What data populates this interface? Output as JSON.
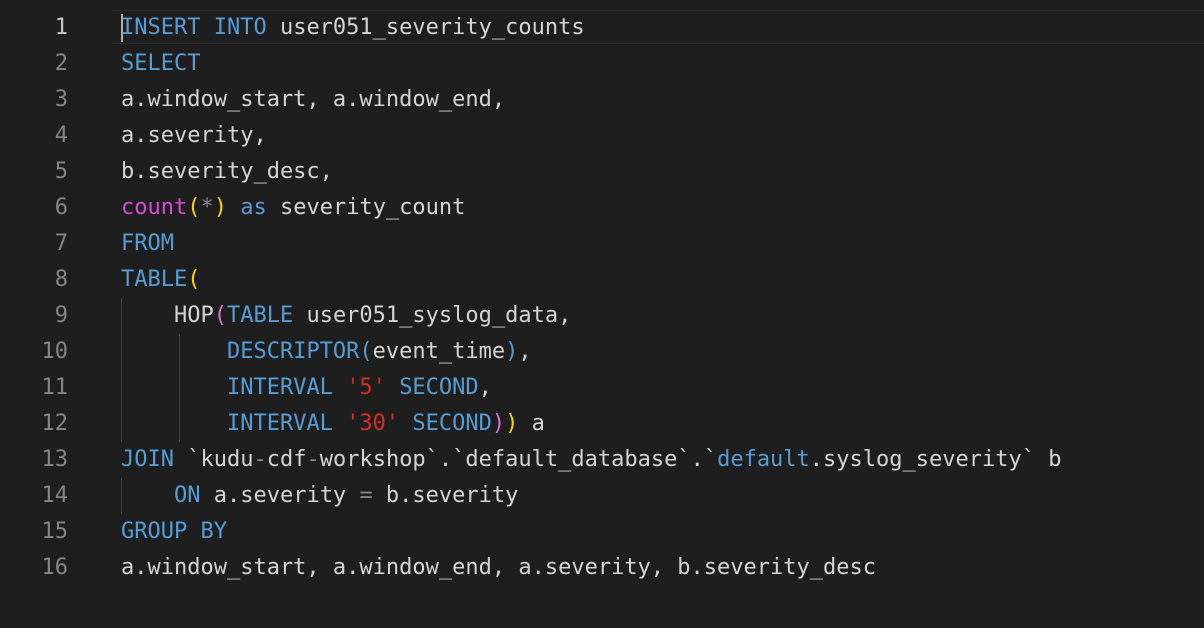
{
  "editor": {
    "language": "sql",
    "colors": {
      "background": "#1e1e1e",
      "line_number": "#858585",
      "line_number_active": "#c6c6c6",
      "text": "#d4d4d4",
      "keyword": "#569cd6",
      "function": "#d44cd4",
      "string": "#d4301f",
      "bracket_level1": "#ffd700",
      "bracket_level2": "#da70d6",
      "bracket_level3": "#569cd6"
    },
    "lines": [
      {
        "number": "1",
        "t": [
          {
            "c": "kw",
            "v": "INSERT INTO"
          },
          {
            "c": "",
            "v": " user051_severity_counts"
          }
        ]
      },
      {
        "number": "2",
        "t": [
          {
            "c": "kw",
            "v": "SELECT"
          }
        ]
      },
      {
        "number": "3",
        "t": [
          {
            "c": "",
            "v": "a.window_start, a.window_end,"
          }
        ]
      },
      {
        "number": "4",
        "t": [
          {
            "c": "",
            "v": "a.severity,"
          }
        ]
      },
      {
        "number": "5",
        "t": [
          {
            "c": "",
            "v": "b.severity_desc,"
          }
        ]
      },
      {
        "number": "6",
        "t": [
          {
            "c": "fn",
            "v": "count"
          },
          {
            "c": "p1",
            "v": "("
          },
          {
            "c": "op",
            "v": "*"
          },
          {
            "c": "p1",
            "v": ")"
          },
          {
            "c": "",
            "v": " "
          },
          {
            "c": "kw",
            "v": "as"
          },
          {
            "c": "",
            "v": " severity_count"
          }
        ]
      },
      {
        "number": "7",
        "t": [
          {
            "c": "kw",
            "v": "FROM"
          }
        ]
      },
      {
        "number": "8",
        "t": [
          {
            "c": "kw",
            "v": "TABLE"
          },
          {
            "c": "p1",
            "v": "("
          }
        ]
      },
      {
        "number": "9",
        "t": [
          {
            "c": "",
            "v": "    HOP"
          },
          {
            "c": "p2",
            "v": "("
          },
          {
            "c": "kw",
            "v": "TABLE"
          },
          {
            "c": "",
            "v": " user051_syslog_data,"
          }
        ]
      },
      {
        "number": "10",
        "t": [
          {
            "c": "",
            "v": "        "
          },
          {
            "c": "kw",
            "v": "DESCRIPTOR"
          },
          {
            "c": "p3",
            "v": "("
          },
          {
            "c": "",
            "v": "event_time"
          },
          {
            "c": "p3",
            "v": ")"
          },
          {
            "c": "",
            "v": ","
          }
        ]
      },
      {
        "number": "11",
        "t": [
          {
            "c": "",
            "v": "        "
          },
          {
            "c": "kw",
            "v": "INTERVAL"
          },
          {
            "c": "",
            "v": " "
          },
          {
            "c": "str",
            "v": "'5'"
          },
          {
            "c": "",
            "v": " "
          },
          {
            "c": "kw",
            "v": "SECOND"
          },
          {
            "c": "",
            "v": ","
          }
        ]
      },
      {
        "number": "12",
        "t": [
          {
            "c": "",
            "v": "        "
          },
          {
            "c": "kw",
            "v": "INTERVAL"
          },
          {
            "c": "",
            "v": " "
          },
          {
            "c": "str",
            "v": "'30'"
          },
          {
            "c": "",
            "v": " "
          },
          {
            "c": "kw",
            "v": "SECOND"
          },
          {
            "c": "p2",
            "v": ")"
          },
          {
            "c": "p1",
            "v": ")"
          },
          {
            "c": "",
            "v": " a"
          }
        ]
      },
      {
        "number": "13",
        "t": [
          {
            "c": "kw",
            "v": "JOIN"
          },
          {
            "c": "",
            "v": " `kudu"
          },
          {
            "c": "op",
            "v": "-"
          },
          {
            "c": "",
            "v": "cdf"
          },
          {
            "c": "op",
            "v": "-"
          },
          {
            "c": "",
            "v": "workshop`.`default_database`.`"
          },
          {
            "c": "kw",
            "v": "default"
          },
          {
            "c": "",
            "v": ".syslog_severity` b"
          }
        ]
      },
      {
        "number": "14",
        "t": [
          {
            "c": "",
            "v": "    "
          },
          {
            "c": "kw",
            "v": "ON"
          },
          {
            "c": "",
            "v": " a.severity "
          },
          {
            "c": "op",
            "v": "="
          },
          {
            "c": "",
            "v": " b.severity"
          }
        ]
      },
      {
        "number": "15",
        "t": [
          {
            "c": "kw",
            "v": "GROUP BY"
          }
        ]
      },
      {
        "number": "16",
        "t": [
          {
            "c": "",
            "v": "a.window_start, a.window_end, a.severity, b.severity_desc"
          }
        ]
      }
    ]
  }
}
